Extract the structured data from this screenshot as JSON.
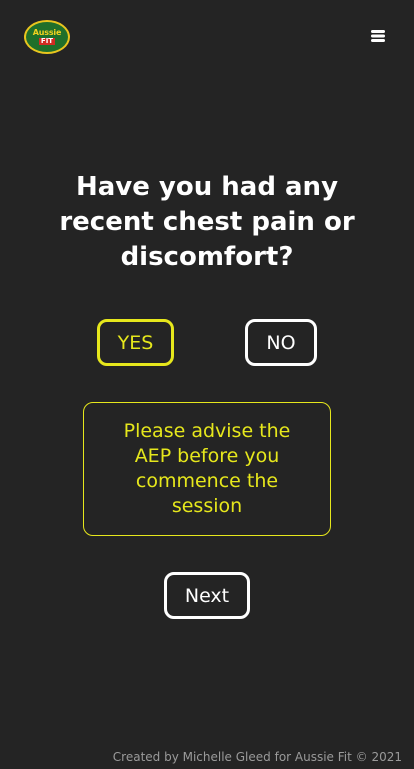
{
  "header": {
    "logo": {
      "line1": "Aussie",
      "line2": "FIT"
    },
    "menu_icon": "hamburger-menu-icon"
  },
  "question": {
    "text": "Have you had any recent chest pain or discomfort?"
  },
  "answers": {
    "yes_label": "YES",
    "no_label": "NO",
    "selected": "YES"
  },
  "advice": {
    "text": "Please advise the AEP before you commence the session"
  },
  "actions": {
    "next_label": "Next"
  },
  "footer": {
    "credit": "Created by Michelle Gleed for Aussie Fit © 2021"
  },
  "colors": {
    "background": "#242424",
    "accent_yellow": "#e6e71c",
    "text": "#ffffff",
    "footer_text": "#9a9a9a"
  }
}
